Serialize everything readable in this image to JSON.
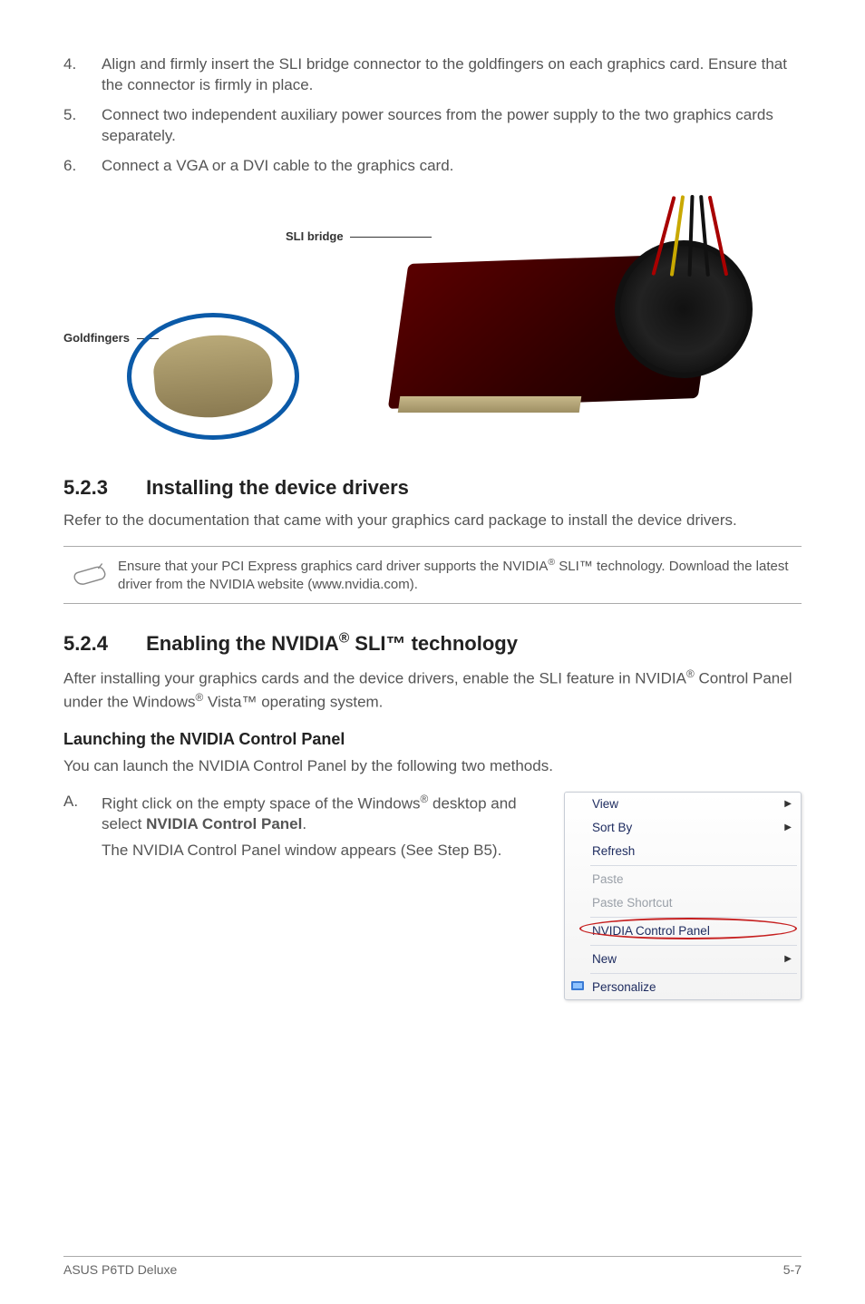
{
  "steps": [
    {
      "num": "4.",
      "text": "Align and firmly insert the SLI bridge connector to the goldfingers on each graphics card. Ensure that the connector is firmly in place."
    },
    {
      "num": "5.",
      "text": "Connect two independent auxiliary power sources from the power supply to the two graphics cards separately."
    },
    {
      "num": "6.",
      "text": "Connect a VGA or a DVI cable to the graphics card."
    }
  ],
  "figure": {
    "sli_label": "SLI bridge",
    "gold_label": "Goldfingers"
  },
  "section523": {
    "num": "5.2.3",
    "title": "Installing the device drivers",
    "body": "Refer to the documentation that came with your graphics card package to install the device drivers.",
    "note_pre": "Ensure that your PCI Express graphics card driver supports the NVIDIA",
    "note_sup": "®",
    "note_post": " SLI™ technology. Download the latest driver from the NVIDIA website (www.nvidia.com)."
  },
  "section524": {
    "num": "5.2.4",
    "title_pre": "Enabling the NVIDIA",
    "title_sup": "®",
    "title_post": " SLI™ technology",
    "body_pre": "After installing your graphics cards and the device drivers, enable the SLI feature in NVIDIA",
    "body_sup1": "®",
    "body_mid": " Control Panel under the Windows",
    "body_sup2": "®",
    "body_post": " Vista™ operating system."
  },
  "launch": {
    "heading": "Launching the NVIDIA Control Panel",
    "intro": "You can launch the NVIDIA Control Panel by the following two methods.",
    "a_letter": "A.",
    "a_line1_pre": "Right click on the empty space of the Windows",
    "a_line1_sup": "®",
    "a_line1_post": " desktop and select ",
    "a_line1_bold": "NVIDIA Control Panel",
    "a_line1_end": ".",
    "a_line2": "The NVIDIA Control Panel window appears (See Step B5)."
  },
  "menu": {
    "view": "View",
    "sortby": "Sort By",
    "refresh": "Refresh",
    "paste": "Paste",
    "paste_shortcut": "Paste Shortcut",
    "nvcp": "NVIDIA Control Panel",
    "new": "New",
    "personalize": "Personalize"
  },
  "footer": {
    "left": "ASUS P6TD Deluxe",
    "right": "5-7"
  }
}
